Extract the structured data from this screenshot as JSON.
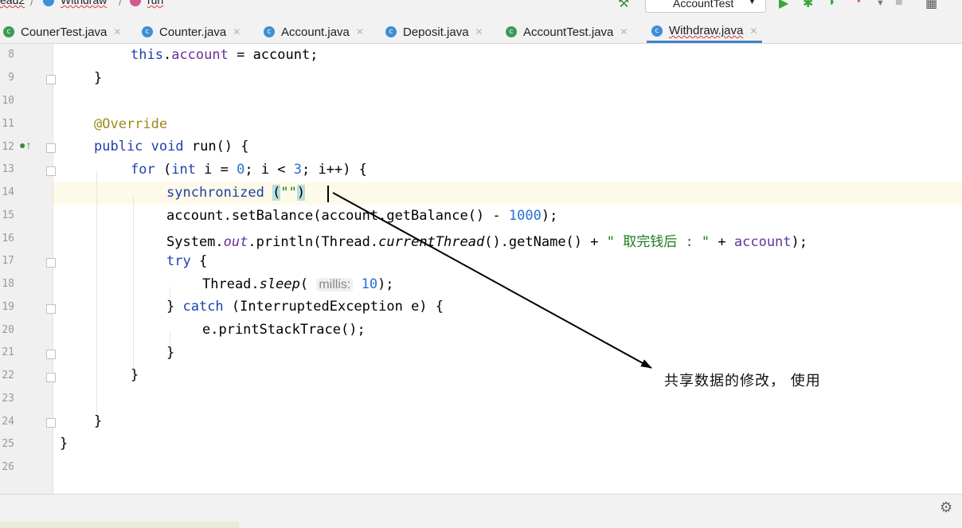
{
  "breadcrumb": {
    "project": "ead2",
    "class": "Withdraw",
    "method": "run"
  },
  "toolbar": {
    "run_config": "AccountTest"
  },
  "tabs": [
    {
      "label": "CounerTest.java",
      "icon": "test-class-icon",
      "active": false
    },
    {
      "label": "Counter.java",
      "icon": "class-icon",
      "active": false
    },
    {
      "label": "Account.java",
      "icon": "class-icon",
      "active": false
    },
    {
      "label": "Deposit.java",
      "icon": "class-icon",
      "active": false
    },
    {
      "label": "AccountTest.java",
      "icon": "test-class-icon",
      "active": false
    },
    {
      "label": "Withdraw.java",
      "icon": "class-icon",
      "active": true
    }
  ],
  "line_numbers": [
    "8",
    "9",
    "10",
    "11",
    "12",
    "13",
    "14",
    "15",
    "16",
    "17",
    "18",
    "19",
    "20",
    "21",
    "22",
    "23",
    "24",
    "25",
    "26"
  ],
  "code": {
    "l8": {
      "kw": "this",
      "dot": ".",
      "field": "account",
      "rest": " = account;"
    },
    "l9": "}",
    "l11": "@Override",
    "l12": {
      "kw1": "public",
      "kw2": "void",
      "name": " run() {"
    },
    "l13": {
      "kw1": "for",
      "open": " (",
      "kw2": "int",
      "a": " i = ",
      "n1": "0",
      "b": "; i < ",
      "n2": "3",
      "c": "; i++) {"
    },
    "l14": {
      "kw": "synchronized",
      "sp": " ",
      "open": "(",
      "str": "\"\"",
      "close": ")"
    },
    "l15": {
      "a": "account.setBalance(account.getBalance() - ",
      "num": "1000",
      "b": ");"
    },
    "l16": {
      "a": "System.",
      "out": "out",
      "b": ".println(Thread.",
      "ct": "currentThread",
      "c": "().getName() + ",
      "str1": "\" 取完钱后 : \"",
      "d": " + ",
      "field": "account",
      "e": ");"
    },
    "l17": {
      "kw": "try",
      "rest": " {"
    },
    "l18": {
      "a": "Thread.",
      "sleep": "sleep",
      "b": "( ",
      "hint": "millis:",
      "num": "10",
      "c": ");"
    },
    "l19": {
      "a": "} ",
      "kw": "catch",
      "b": " (InterruptedException e) {"
    },
    "l20": "e.printStackTrace();",
    "l21": "}",
    "l22": "}",
    "l24": "}",
    "l25": "}"
  },
  "annotation_note": "共享数据的修改， 使用",
  "colors": {
    "keyword": "#1f3fad",
    "field": "#6a2f9a",
    "number": "#2a6fd6",
    "string": "#1e7b1e",
    "annotation": "#9e8a1b",
    "arrow": "#000000"
  }
}
